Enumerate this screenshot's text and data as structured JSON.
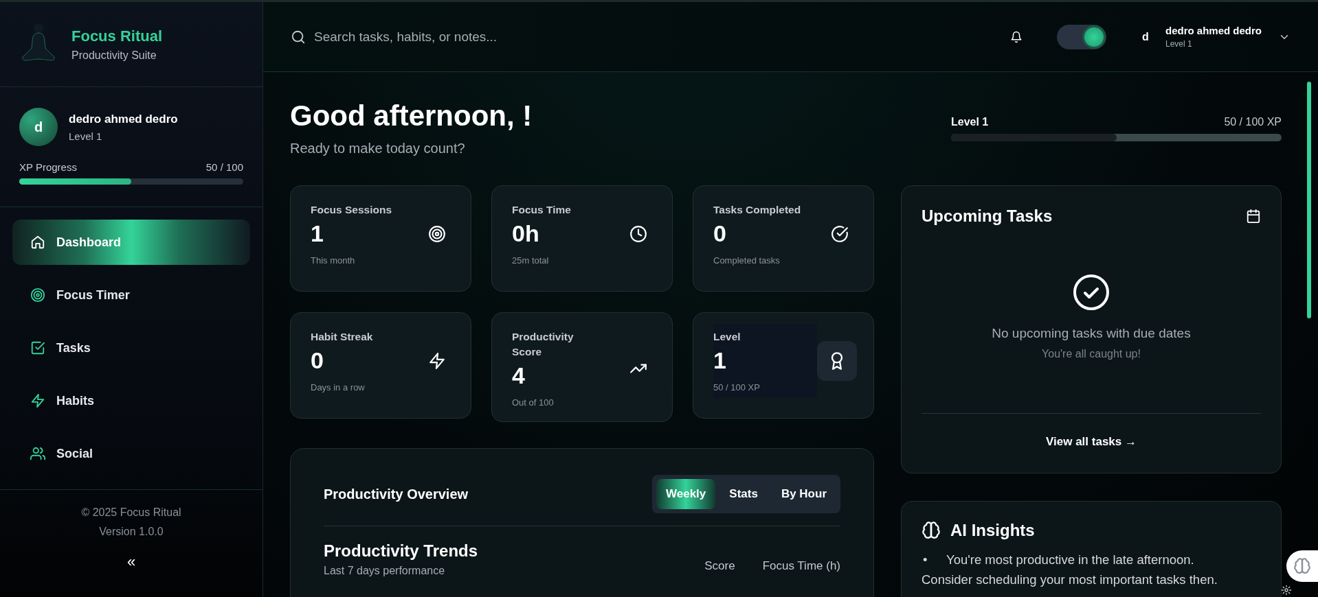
{
  "sidebar": {
    "brand": {
      "title": "Focus Ritual",
      "subtitle": "Productivity Suite"
    },
    "user": {
      "avatar": "d",
      "name": "dedro ahmed dedro",
      "level_text": "Level 1",
      "xp": {
        "label": "XP Progress",
        "value": "50 / 100",
        "level": 0.5
      }
    },
    "nav": [
      {
        "label": "Dashboard",
        "kind": "home",
        "selected": true
      },
      {
        "label": "Focus Timer",
        "kind": "target",
        "selected": false
      },
      {
        "label": "Tasks",
        "kind": "checkbox",
        "selected": false
      },
      {
        "label": "Habits",
        "kind": "bolt",
        "selected": false
      },
      {
        "label": "Social",
        "kind": "people",
        "selected": false
      }
    ],
    "footer": {
      "copyright": "© 2025 Focus Ritual",
      "version": "Version 1.0.0",
      "collapse": "«"
    }
  },
  "header": {
    "search": {
      "placeholder": "Search tasks, habits, or notes..."
    },
    "theme_toggle": {
      "on": true
    },
    "user": {
      "avatar": "d",
      "name": "dedro ahmed dedro",
      "level_text": "Level 1"
    }
  },
  "greeting": {
    "title": "Good afternoon, !",
    "subtitle": "Ready to make today count?"
  },
  "level_bar": {
    "label": "Level 1",
    "value": "50 / 100 XP",
    "level": 0.5
  },
  "stats": [
    {
      "title": "Focus Sessions",
      "value": "1",
      "note": "This month",
      "kind": "target"
    },
    {
      "title": "Focus Time",
      "value": "0h",
      "note": "25m total",
      "kind": "clock"
    },
    {
      "title": "Tasks Completed",
      "value": "0",
      "note": "Completed tasks",
      "kind": "check"
    },
    {
      "title": "Habit Streak",
      "value": "0",
      "note": "Days in a row",
      "kind": "bolt"
    },
    {
      "title": "Productivity Score",
      "value": "4",
      "note": "Out of 100",
      "kind": "trend"
    },
    {
      "title": "Level",
      "value": "1",
      "note": "50 / 100 XP",
      "kind": "award"
    }
  ],
  "overview": {
    "title": "Productivity Overview",
    "tabs": [
      {
        "label": "Weekly",
        "selected": true
      },
      {
        "label": "Stats",
        "selected": false
      },
      {
        "label": "By Hour",
        "selected": false
      }
    ],
    "trends": {
      "title": "Productivity Trends",
      "subtitle": "Last 7 days performance",
      "legend": [
        "Score",
        "Focus Time (h)"
      ]
    }
  },
  "upcoming": {
    "title": "Upcoming Tasks",
    "empty_title": "No upcoming tasks with due dates",
    "empty_note": "You're all caught up!",
    "link": "View all tasks →"
  },
  "insights": {
    "title": "AI Insights",
    "items": [
      {
        "marker": "•",
        "text": "You're most productive in the late afternoon. Consider scheduling your most important tasks then."
      }
    ]
  }
}
